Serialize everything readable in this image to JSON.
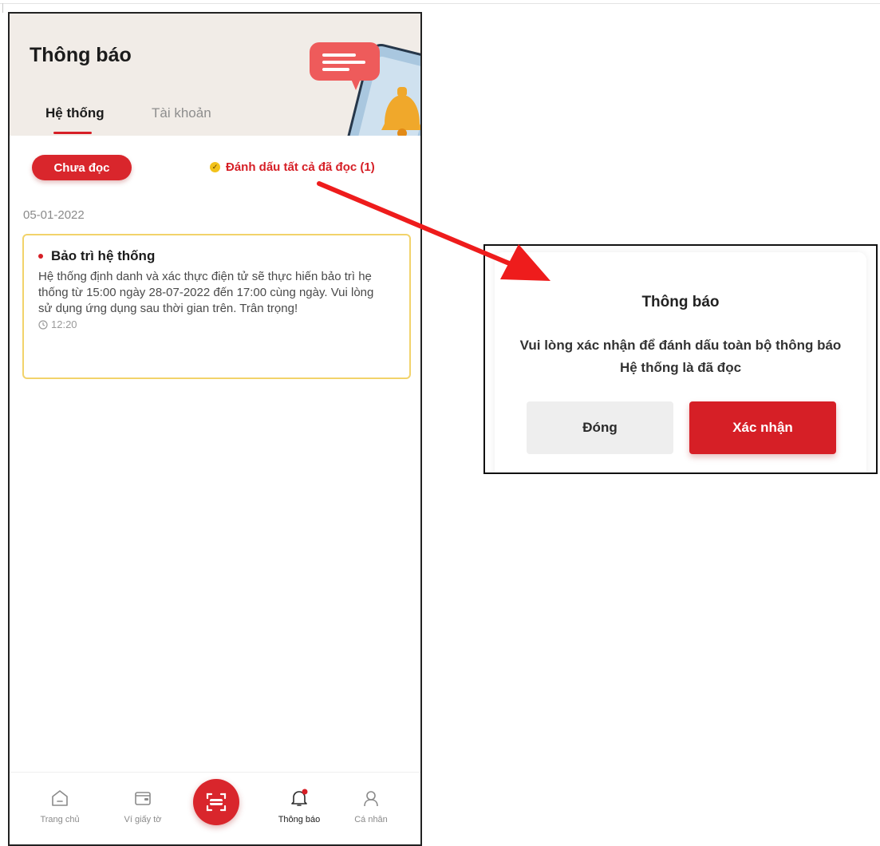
{
  "header": {
    "title": "Thông báo",
    "tabs": [
      {
        "label": "Hệ thống",
        "active": true
      },
      {
        "label": "Tài khoản",
        "active": false
      }
    ]
  },
  "filter": {
    "unread_chip": "Chưa đọc",
    "mark_all_read": "Đánh dấu tất cả đã đọc (1)"
  },
  "notifications": {
    "date": "05-01-2022",
    "items": [
      {
        "title": "Bảo trì hệ thống",
        "body": "Hệ thống định danh và xác thực điện tử sẽ thực hiến bảo trì hẹ thống từ 15:00 ngày 28-07-2022 đến 17:00 cùng ngày. Vui lòng sử dụng ứng dụng sau thời gian trên. Trân trọng!",
        "time": "12:20",
        "unread": true
      }
    ]
  },
  "bottom_nav": {
    "items": [
      {
        "label": "Trang chủ",
        "icon": "home-icon"
      },
      {
        "label": "Ví giấy tờ",
        "icon": "wallet-icon"
      },
      {
        "label": "Thông báo",
        "icon": "bell-icon",
        "active": true
      },
      {
        "label": "Cá nhân",
        "icon": "user-icon"
      }
    ],
    "center_icon": "scan-icon"
  },
  "dialog": {
    "title": "Thông báo",
    "message": "Vui lòng xác nhận để đánh dấu toàn bộ thông báo Hệ thống là đã đọc",
    "close_label": "Đóng",
    "confirm_label": "Xác nhận"
  },
  "colors": {
    "primary": "#d61f26",
    "header_bg": "#f1ece7",
    "card_border": "#f2d36b",
    "check_yellow": "#f2c21b"
  }
}
